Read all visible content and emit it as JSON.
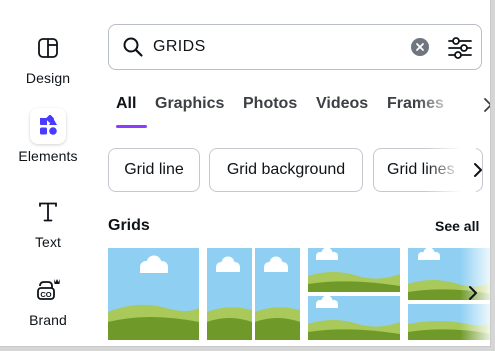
{
  "rail": {
    "items": [
      {
        "label": "Design",
        "icon": "design-icon"
      },
      {
        "label": "Elements",
        "icon": "elements-icon",
        "active": true
      },
      {
        "label": "Text",
        "icon": "text-icon"
      },
      {
        "label": "Brand",
        "icon": "brand-icon"
      }
    ]
  },
  "search": {
    "value": "GRIDS",
    "icon": "search-icon",
    "clear_icon": "clear-icon",
    "filter_icon": "filter-icon"
  },
  "tabs": [
    "All",
    "Graphics",
    "Photos",
    "Videos",
    "Frames"
  ],
  "active_tab": "All",
  "chips": [
    "Grid line",
    "Grid background",
    "Grid lines"
  ],
  "section": {
    "title": "Grids",
    "see_all": "See all"
  },
  "colors": {
    "accent": "#8b3dff",
    "sky": "#8fd0f2",
    "grass_dark": "#6f9a2a",
    "grass_light": "#a9c95a"
  }
}
